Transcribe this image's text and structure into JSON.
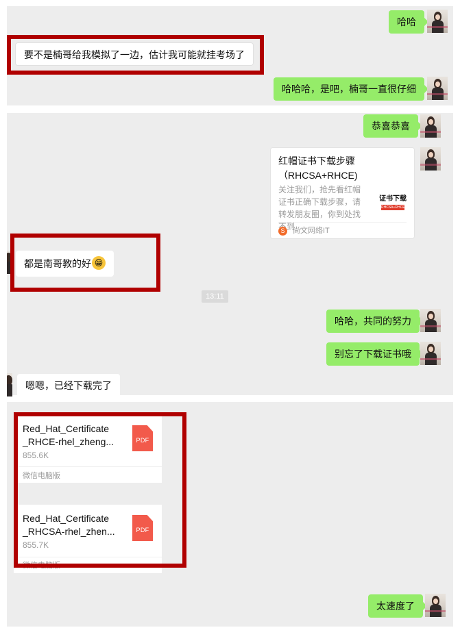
{
  "panel1": {
    "m1": "哈哈",
    "m2": "要不是楠哥给我模拟了一边，估计我可能就挂考场了",
    "m3": "哈哈哈，是吧，楠哥一直很仔细"
  },
  "panel2": {
    "m1": "恭喜恭喜",
    "share": {
      "title": "红帽证书下载步骤（RHCSA+RHCE)",
      "desc": "关注我们，抢先看红帽证书正确下载步骤，请转发朋友圈，你到处找不到...",
      "thumb_title": "证书下载",
      "thumb_caption": "RHCSA+RHCE",
      "source": "尚文网络IT"
    },
    "m2": "都是南哥教的好",
    "emoji": "😁",
    "time": "13:11",
    "m3": "哈哈，共同的努力",
    "m4": "别忘了下载证书哦",
    "m5": "嗯嗯，已经下载完了"
  },
  "panel3": {
    "files": [
      {
        "name_line1": "Red_Hat_Certificate",
        "name_line2": "_RHCE-rhel_zheng...",
        "size": "855.6K",
        "icon": "PDF",
        "footer": "微信电脑版"
      },
      {
        "name_line1": "Red_Hat_Certificate",
        "name_line2": "_RHCSA-rhel_zhen...",
        "size": "855.7K",
        "icon": "PDF",
        "footer": "微信电脑版"
      }
    ],
    "m1": "太速度了"
  },
  "colors": {
    "my_bubble": "#95ec69",
    "highlight_border": "#b00000",
    "pdf": "#f25a4b"
  }
}
